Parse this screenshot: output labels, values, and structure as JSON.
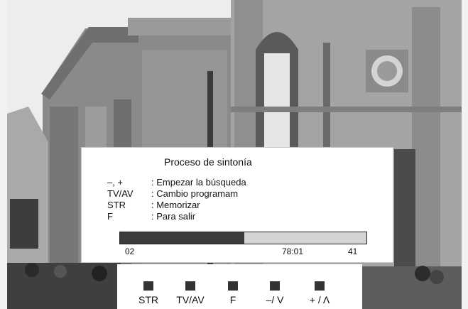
{
  "osd": {
    "title": "Proceso de sintonía",
    "instructions": [
      {
        "key": "–, +",
        "desc": ": Empezar la búsqueda"
      },
      {
        "key": "TV/AV",
        "desc": ": Cambio programam"
      },
      {
        "key": "STR",
        "desc": ": Memorizar"
      },
      {
        "key": "F",
        "desc": ": Para salir"
      }
    ],
    "progress": {
      "fraction": 0.505,
      "channel": "02",
      "frequency": "78:01",
      "program": "41"
    }
  },
  "buttons": [
    {
      "label": "STR"
    },
    {
      "label": "TV/AV"
    },
    {
      "label": "F"
    },
    {
      "label": "–/ V"
    },
    {
      "label": "+ / Λ"
    }
  ],
  "colors": {
    "progress_fill": "#3c3c3c",
    "progress_track": "#d4d4d4"
  },
  "background": {
    "scene": "black-and-white photo of classical stone buildings and a crowd of people"
  }
}
